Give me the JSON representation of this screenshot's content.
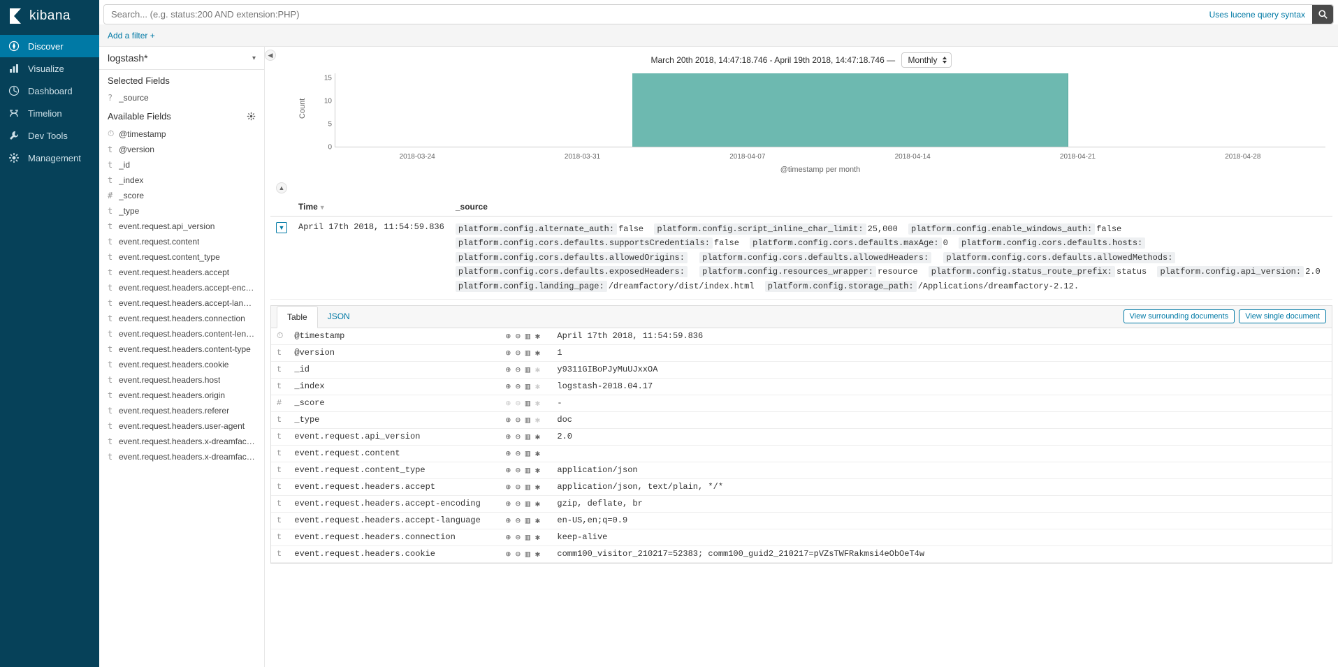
{
  "app": {
    "name": "kibana"
  },
  "nav": [
    {
      "id": "discover",
      "label": "Discover",
      "active": true
    },
    {
      "id": "visualize",
      "label": "Visualize",
      "active": false
    },
    {
      "id": "dashboard",
      "label": "Dashboard",
      "active": false
    },
    {
      "id": "timelion",
      "label": "Timelion",
      "active": false
    },
    {
      "id": "devtools",
      "label": "Dev Tools",
      "active": false
    },
    {
      "id": "management",
      "label": "Management",
      "active": false
    }
  ],
  "search": {
    "placeholder": "Search... (e.g. status:200 AND extension:PHP)",
    "lucene_link": "Uses lucene query syntax"
  },
  "filterbar": {
    "add_filter": "Add a filter",
    "plus": "+"
  },
  "index_pattern": "logstash*",
  "selected_fields_label": "Selected Fields",
  "available_fields_label": "Available Fields",
  "selected_fields": [
    {
      "type": "?",
      "name": "_source"
    }
  ],
  "available_fields": [
    {
      "type": "⏱",
      "name": "@timestamp"
    },
    {
      "type": "t",
      "name": "@version"
    },
    {
      "type": "t",
      "name": "_id"
    },
    {
      "type": "t",
      "name": "_index"
    },
    {
      "type": "#",
      "name": "_score"
    },
    {
      "type": "t",
      "name": "_type"
    },
    {
      "type": "t",
      "name": "event.request.api_version"
    },
    {
      "type": "t",
      "name": "event.request.content"
    },
    {
      "type": "t",
      "name": "event.request.content_type"
    },
    {
      "type": "t",
      "name": "event.request.headers.accept"
    },
    {
      "type": "t",
      "name": "event.request.headers.accept-enco..."
    },
    {
      "type": "t",
      "name": "event.request.headers.accept-langu..."
    },
    {
      "type": "t",
      "name": "event.request.headers.connection"
    },
    {
      "type": "t",
      "name": "event.request.headers.content-length"
    },
    {
      "type": "t",
      "name": "event.request.headers.content-type"
    },
    {
      "type": "t",
      "name": "event.request.headers.cookie"
    },
    {
      "type": "t",
      "name": "event.request.headers.host"
    },
    {
      "type": "t",
      "name": "event.request.headers.origin"
    },
    {
      "type": "t",
      "name": "event.request.headers.referer"
    },
    {
      "type": "t",
      "name": "event.request.headers.user-agent"
    },
    {
      "type": "t",
      "name": "event.request.headers.x-dreamfact..."
    },
    {
      "type": "t",
      "name": "event.request.headers.x-dreamfact..."
    }
  ],
  "timerange": {
    "text": "March 20th 2018, 14:47:18.746 - April 19th 2018, 14:47:18.746 —",
    "interval": "Monthly"
  },
  "chart_data": {
    "type": "bar",
    "ylabel": "Count",
    "xlabel": "@timestamp per month",
    "ylim": [
      0,
      16
    ],
    "yticks": [
      0,
      5,
      10,
      15
    ],
    "xticks": [
      "2018-03-24",
      "2018-03-31",
      "2018-04-07",
      "2018-04-14",
      "2018-04-21",
      "2018-04-28"
    ],
    "bars": [
      {
        "left_pct": 30.0,
        "width_pct": 44.0,
        "value": 16
      }
    ]
  },
  "columns": {
    "time": "Time",
    "source": "_source"
  },
  "doc": {
    "time": "April 17th 2018, 11:54:59.836",
    "source_kv": [
      {
        "k": "platform.config.alternate_auth:",
        "v": "false"
      },
      {
        "k": "platform.config.script_inline_char_limit:",
        "v": "25,000"
      },
      {
        "k": "platform.config.enable_windows_auth:",
        "v": "false"
      },
      {
        "k": "platform.config.cors.defaults.supportsCredentials:",
        "v": "false"
      },
      {
        "k": "platform.config.cors.defaults.maxAge:",
        "v": "0"
      },
      {
        "k": "platform.config.cors.defaults.hosts:",
        "v": ""
      },
      {
        "k": "platform.config.cors.defaults.allowedOrigins:",
        "v": ""
      },
      {
        "k": "platform.config.cors.defaults.allowedHeaders:",
        "v": ""
      },
      {
        "k": "platform.config.cors.defaults.allowedMethods:",
        "v": ""
      },
      {
        "k": "platform.config.cors.defaults.exposedHeaders:",
        "v": ""
      },
      {
        "k": "platform.config.resources_wrapper:",
        "v": "resource"
      },
      {
        "k": "platform.config.status_route_prefix:",
        "v": "status"
      },
      {
        "k": "platform.config.api_version:",
        "v": "2.0"
      },
      {
        "k": "platform.config.landing_page:",
        "v": "/dreamfactory/dist/index.html"
      },
      {
        "k": "platform.config.storage_path:",
        "v": "/Applications/dreamfactory-2.12."
      }
    ]
  },
  "detail": {
    "tabs": {
      "table": "Table",
      "json": "JSON"
    },
    "surrounding": "View surrounding documents",
    "single": "View single document",
    "rows": [
      {
        "type": "⏱",
        "name": "@timestamp",
        "dim": false,
        "value": "April 17th 2018, 11:54:59.836"
      },
      {
        "type": "t",
        "name": "@version",
        "dim": false,
        "value": "1"
      },
      {
        "type": "t",
        "name": "_id",
        "dim": true,
        "value": "y9311GIBoPJyMuUJxxOA"
      },
      {
        "type": "t",
        "name": "_index",
        "dim": true,
        "value": "logstash-2018.04.17"
      },
      {
        "type": "#",
        "name": "_score",
        "dim": true,
        "value": "-",
        "dimplus": true
      },
      {
        "type": "t",
        "name": "_type",
        "dim": true,
        "value": "doc"
      },
      {
        "type": "t",
        "name": "event.request.api_version",
        "dim": false,
        "value": "2.0"
      },
      {
        "type": "t",
        "name": "event.request.content",
        "dim": false,
        "value": ""
      },
      {
        "type": "t",
        "name": "event.request.content_type",
        "dim": false,
        "value": "application/json"
      },
      {
        "type": "t",
        "name": "event.request.headers.accept",
        "dim": false,
        "value": "application/json, text/plain, */*"
      },
      {
        "type": "t",
        "name": "event.request.headers.accept-encoding",
        "dim": false,
        "value": "gzip, deflate, br"
      },
      {
        "type": "t",
        "name": "event.request.headers.accept-language",
        "dim": false,
        "value": "en-US,en;q=0.9"
      },
      {
        "type": "t",
        "name": "event.request.headers.connection",
        "dim": false,
        "value": "keep-alive"
      },
      {
        "type": "t",
        "name": "event.request.headers.cookie",
        "dim": false,
        "value": "comm100_visitor_210217=52383; comm100_guid2_210217=pVZsTWFRakmsi4eObOeT4w"
      }
    ]
  }
}
